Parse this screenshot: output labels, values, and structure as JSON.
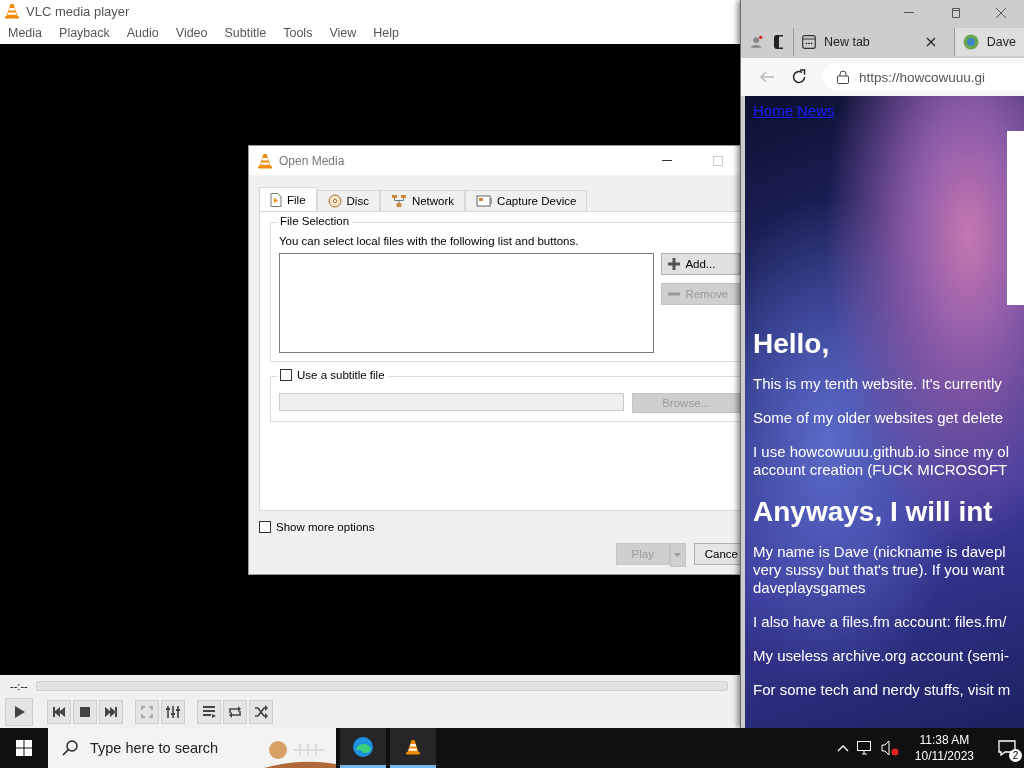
{
  "vlc": {
    "title": "VLC media player",
    "menu": [
      "Media",
      "Playback",
      "Audio",
      "Video",
      "Subtitle",
      "Tools",
      "View",
      "Help"
    ],
    "time": "--:--"
  },
  "open_media": {
    "title": "Open Media",
    "tabs": [
      {
        "label": "File",
        "selected": true
      },
      {
        "label": "Disc",
        "selected": false
      },
      {
        "label": "Network",
        "selected": false
      },
      {
        "label": "Capture Device",
        "selected": false
      }
    ],
    "file_selection": {
      "legend": "File Selection",
      "hint": "You can select local files with the following list and buttons.",
      "buttons": [
        {
          "label": "Add...",
          "disabled": false
        },
        {
          "label": "Remove",
          "disabled": true
        }
      ]
    },
    "subtitle": {
      "label": "Use a subtitle file",
      "checked": false,
      "browse": {
        "label": "Browse...",
        "disabled": true
      }
    },
    "show_more": {
      "label": "Show more options",
      "checked": false
    },
    "buttons": [
      {
        "label": "Play",
        "disabled": true
      },
      {
        "label": "Cance",
        "disabled": false
      }
    ]
  },
  "browser": {
    "tabs": [
      {
        "label": "New tab",
        "selected": false
      },
      {
        "label": "Dave",
        "selected": true
      }
    ],
    "url": "https://howcowuuu.gi",
    "nav_links": [
      "Home",
      "News"
    ],
    "content": [
      {
        "kind": "heading",
        "lines": [
          "Hello,"
        ]
      },
      {
        "kind": "paragraph",
        "lines": [
          "This is my tenth website. It's currently"
        ]
      },
      {
        "kind": "paragraph",
        "lines": [
          "Some of my older websites get delete"
        ]
      },
      {
        "kind": "paragraph",
        "lines": [
          "I use howcowuuu.github.io since my ol",
          "account creation (FUCK MICROSOFT"
        ]
      },
      {
        "kind": "heading",
        "lines": [
          "Anyways, I will int"
        ]
      },
      {
        "kind": "paragraph",
        "lines": [
          "My name is Dave (nickname is davepl",
          "very sussy but that's true). If you want",
          "daveplaysgames"
        ]
      },
      {
        "kind": "paragraph",
        "lines": [
          "I also have a files.fm account: files.fm/"
        ]
      },
      {
        "kind": "paragraph",
        "lines": [
          "My useless archive.org account (semi-"
        ]
      },
      {
        "kind": "paragraph",
        "lines": [
          "For some tech and nerdy stuffs, visit m"
        ]
      }
    ]
  },
  "taskbar": {
    "search_placeholder": "Type here to search",
    "apps": [
      {
        "kind": "edge",
        "running": true
      },
      {
        "kind": "vlc",
        "running": true
      }
    ],
    "time": "11:38 AM",
    "date": "10/11/2023",
    "notifications": "2"
  }
}
